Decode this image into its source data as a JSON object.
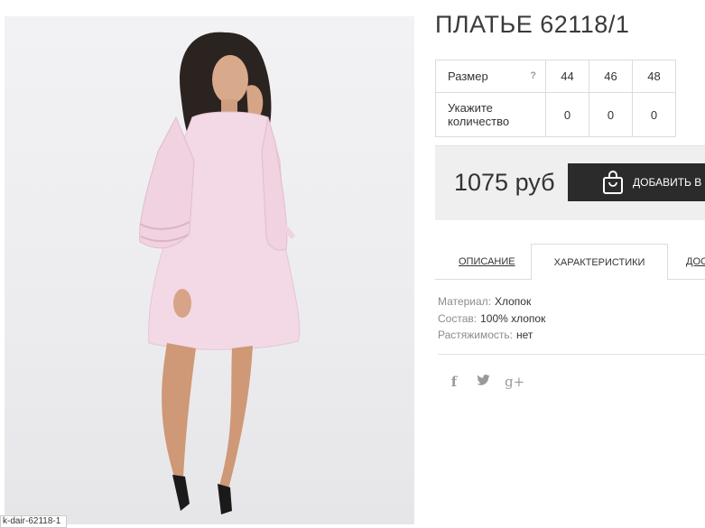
{
  "product": {
    "title": "ПЛАТЬЕ 62118/1",
    "image_caption": "k-dair-62118-1"
  },
  "sizes": {
    "size_label": "Размер",
    "help_label": "?",
    "quantity_label": "Укажите количество",
    "columns": [
      "44",
      "46",
      "48"
    ],
    "quantities": [
      "0",
      "0",
      "0"
    ]
  },
  "buy": {
    "price": "1075 руб",
    "cart_label": "ДОБАВИТЬ В З"
  },
  "tabs": [
    {
      "label": "ОПИСАНИЕ"
    },
    {
      "label": "ХАРАКТЕРИСТИКИ",
      "active": true
    },
    {
      "label": "ДОС"
    }
  ],
  "characteristics": [
    {
      "key": "Материал:",
      "value": "Хлопок"
    },
    {
      "key": "Состав:",
      "value": "100% хлопок"
    },
    {
      "key": "Растяжимость:",
      "value": "нет"
    }
  ],
  "social": {
    "facebook": "f",
    "twitter": "twitter-icon",
    "googleplus": "g+"
  },
  "colors": {
    "dress": "#f3d9e6",
    "button": "#2b2b2b",
    "panel": "#efefef"
  }
}
